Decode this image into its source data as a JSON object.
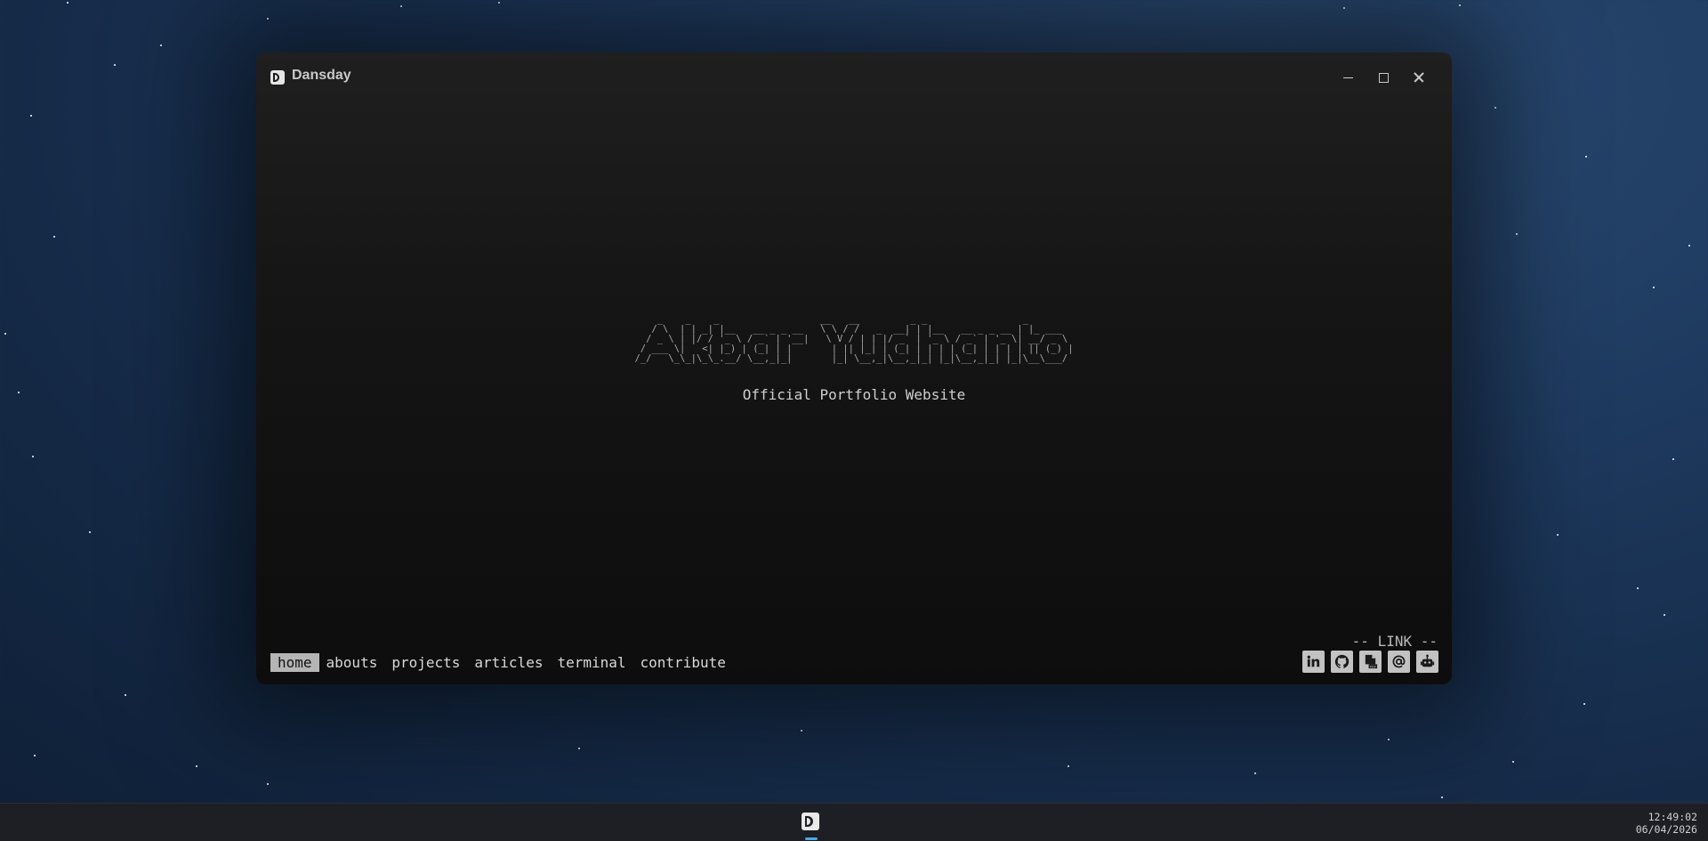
{
  "window": {
    "title": "Dansday",
    "icon": "dansday-d-logo-icon",
    "controls": [
      "minimize-icon",
      "maximize-icon",
      "close-icon"
    ]
  },
  "hero": {
    "ascii_art": "    _    _    _                  __   __         _ _                 _        \n   / \\  | | _| |__   __ _ _ __   \\ \\ / /   _  __| | |__   __ _ _ __ | |_ ___  \n  / _ \\ | |/ / '_ \\ / _` | '__|   \\ V / | | |/ _` | '_ \\ / _` | '_ \\| __/ _ \\ \n / ___ \\|   <| |_) | (_| | |       | || |_| | (_| | | | | (_| | | | | || (_) |\n/_/   \\_\\_|\\_\\_.__/ \\__,_|_|       |_| \\__,_|\\__,_|_| |_|\\__,_|_| |_|\\__\\___/ ",
    "subtitle": "Official Portfolio Website"
  },
  "nav": {
    "items": [
      "home",
      "abouts",
      "projects",
      "articles",
      "terminal",
      "contribute"
    ],
    "active": "home"
  },
  "links": {
    "label": "-- LINK --",
    "icons": [
      "linkedin-icon",
      "github-icon",
      "pdf-file-icon",
      "at-sign-icon",
      "robot-icon"
    ]
  },
  "taskbar": {
    "time": "12:49:02",
    "date": "06/04/2026"
  },
  "colors": {
    "desktop_bg": "#1e3a5f",
    "window_bg": "#151515",
    "nav_active_bg": "#b5b5b5",
    "taskbar_bg": "#1d1f24",
    "taskbar_indicator": "#4aa8e8"
  }
}
